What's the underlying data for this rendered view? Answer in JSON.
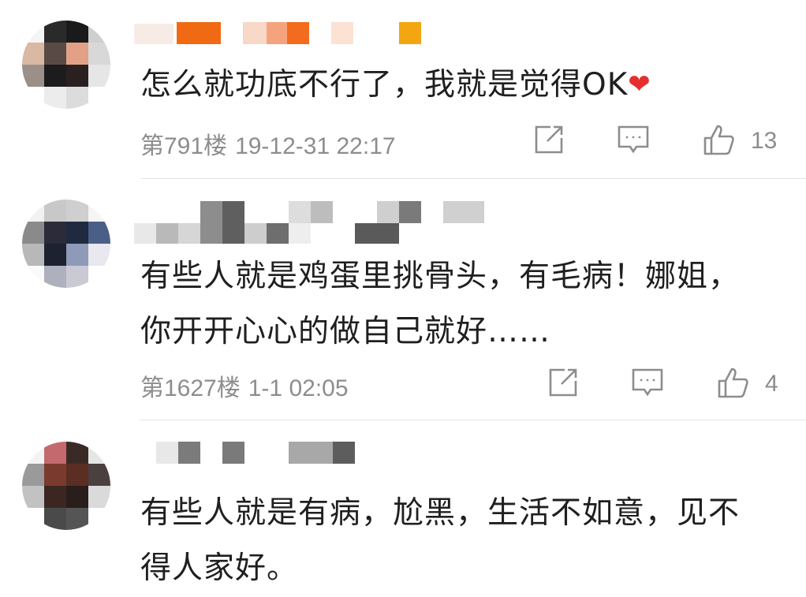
{
  "comments": [
    {
      "text": "怎么就功底不行了，我就是觉得OK",
      "heart": "❤",
      "floor": "第791楼",
      "time": "19-12-31 22:17",
      "likes": "13"
    },
    {
      "text": "有些人就是鸡蛋里挑骨头，有毛病！娜姐，\n你开开心心的做自己就好……",
      "floor": "第1627楼",
      "time": "1-1 02:05",
      "likes": "4"
    },
    {
      "text": "有些人就是有病，尬黑，生活不如意，见不\n得人家好。"
    }
  ],
  "icons": {
    "share": "share-icon",
    "comment": "comment-icon",
    "like": "thumbs-up-icon"
  },
  "colors": {
    "meta_text": "#8d8d8d",
    "heart": "#e52f2f",
    "divider": "#e2e2e2"
  }
}
